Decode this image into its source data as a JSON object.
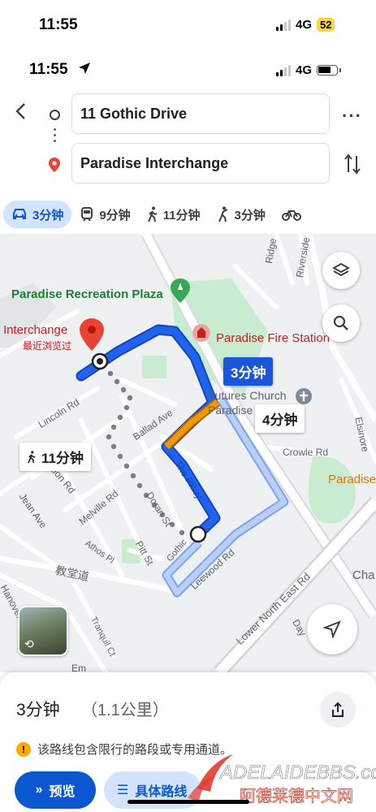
{
  "status_bar_outer": {
    "time": "11:55",
    "network": "4G",
    "battery": "52"
  },
  "status_bar_inner": {
    "time": "11:55",
    "network": "4G"
  },
  "directions": {
    "origin": "11 Gothic Drive",
    "destination": "Paradise Interchange"
  },
  "modes": [
    {
      "icon": "car-icon",
      "label": "3分钟"
    },
    {
      "icon": "transit-icon",
      "label": "9分钟"
    },
    {
      "icon": "walk-icon",
      "label": "11分钟"
    },
    {
      "icon": "ride-icon",
      "label": "3分钟"
    }
  ],
  "map": {
    "places": {
      "recreation_plaza": "Paradise Recreation Plaza",
      "fire_station": "Paradise Fire Station",
      "interchange": "Interchange",
      "recently_viewed": "最近浏览过",
      "church_1": "Futures Church",
      "church_2": "Paradise Ca",
      "paradise": "Paradise",
      "cha": "Cha"
    },
    "streets": {
      "ridge": "Ridge",
      "riverside": "Riverside",
      "lincoln": "Lincoln Rd",
      "ballad": "Ballad Ave",
      "crowle": "Crowle Rd",
      "elsinore": "Elsinore",
      "ction": "ction Rd",
      "jean": "Jean Ave",
      "melville": "Melville Rd",
      "doran": "Doran St",
      "pkwy": "The Pkwy",
      "athos": "Athos Pl",
      "pitt": "Pitt St",
      "gothic": "Gothic",
      "leewood": "Leewood Rd",
      "jiaotang": "教堂道",
      "lower_ne": "Lower North East Rd",
      "tranquil": "Tranquil Ct",
      "hanover": "Hanover",
      "day": "Day",
      "em": "Em"
    },
    "bubbles": {
      "driving_selected": "3分钟",
      "driving_alt": "4分钟",
      "walking": "11分钟"
    }
  },
  "summary": {
    "time": "3分钟",
    "distance": "（1.1公里）",
    "warning": "该路线包含限行的路段或专用通道。",
    "preview_label": "预览",
    "steps_label": "具体路线"
  },
  "watermark": {
    "brand": "ADELAIDEBBS.com",
    "sub": "阿德莱德中文网"
  },
  "colors": {
    "route_selected": "#1a56d9",
    "route_alt": "#a7c2f4",
    "traffic_slow": "#f29900",
    "accent": "#0b57d0",
    "pin_red": "#ea4335",
    "park_green": "#c9ecd1"
  }
}
